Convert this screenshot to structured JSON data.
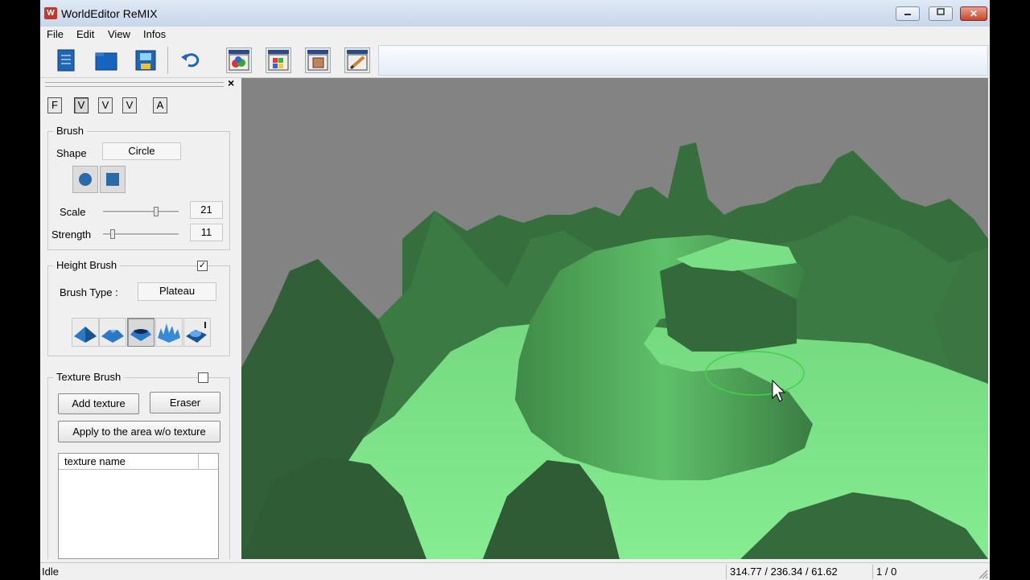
{
  "window": {
    "title": "WorldEditor ReMIX",
    "controls": {
      "minimize": "▭",
      "maximize": "□",
      "close": "✕"
    }
  },
  "menu": [
    "File",
    "Edit",
    "View",
    "Infos"
  ],
  "toolbar": {
    "left_icons": [
      "new-document-icon",
      "open-folder-icon",
      "save-icon",
      "undo-icon"
    ],
    "right_icons": [
      "objects-palette-icon",
      "terrain-palette-icon",
      "texture-palette-icon",
      "paint-brush-icon"
    ]
  },
  "panel": {
    "close": "×",
    "modes": [
      "F",
      "V",
      "V",
      "V",
      "A"
    ],
    "brush": {
      "legend": "Brush",
      "shape_label": "Shape",
      "shape_value": "Circle",
      "scale_label": "Scale",
      "scale_value": "21",
      "strength_label": "Strength",
      "strength_value": "11"
    },
    "height_brush": {
      "legend": "Height Brush",
      "checked": "✓",
      "type_label": "Brush Type :",
      "type_value": "Plateau",
      "type_icons": [
        "raise-brush-icon",
        "smooth-brush-icon",
        "plateau-brush-icon",
        "noise-brush-icon",
        "erase-brush-icon"
      ]
    },
    "texture_brush": {
      "legend": "Texture Brush",
      "add_label": "Add texture",
      "eraser_label": "Eraser",
      "apply_label": "Apply to the area w/o texture",
      "column_header": "texture name"
    }
  },
  "status": {
    "state": "Idle",
    "coords": "314.77 / 236.34 / 61.62",
    "page": "1 / 0"
  },
  "colors": {
    "terrain_light": "#7fe38a",
    "terrain_dark": "#2f6a36",
    "sky": "#838383"
  }
}
